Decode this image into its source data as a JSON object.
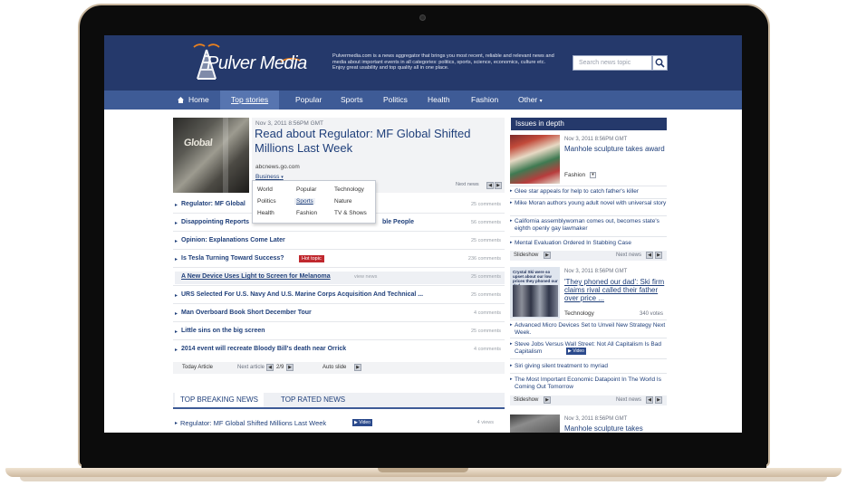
{
  "header": {
    "logo_text": "Pulver Media",
    "tagline": "Pulvermedia.com is a news aggregator that brings you most recent, reliable and relevant news and media about important events in all categories: politics, sports, science, economics, culture etc. Enjoy great usability and top quality all in one place.",
    "search_placeholder": "Search news topic"
  },
  "nav": {
    "home": "Home",
    "items": [
      "Top stories",
      "Popular",
      "Sports",
      "Politics",
      "Health",
      "Fashion",
      "Other"
    ],
    "active": "Top stories"
  },
  "featured": {
    "date": "Nov 3, 2011 8:56PM GMT",
    "title": "Read about Regulator: MF Global Shifted Millions Last Week",
    "source": "abcnews.go.com",
    "category": "Business",
    "image_text": "Global",
    "next_news": "Next news"
  },
  "category_dropdown": {
    "items": [
      [
        "World",
        "Popular",
        "Technology"
      ],
      [
        "Politics",
        "Sports",
        "Nature"
      ],
      [
        "Health",
        "Fashion",
        "TV & Shows"
      ]
    ],
    "active": "Sports"
  },
  "stories": [
    {
      "title": "Regulator: MF Global",
      "comments": "25 comments"
    },
    {
      "title": "Disappointing Reports",
      "title_tail": "ble People",
      "comments": "56 comments"
    },
    {
      "title": "Opinion: Explanations Come Later",
      "comments": "25 comments"
    },
    {
      "title": "Is Tesla Turning Toward Success?",
      "badge": "Hot topic",
      "comments": "236 comments"
    },
    {
      "title": "A New Device Uses Light to Screen for Melanoma",
      "extra": "view news",
      "comments": "25 comments"
    },
    {
      "title": "URS Selected For U.S. Navy And U.S. Marine Corps Acquisition And Technical ...",
      "comments": "25 comments"
    },
    {
      "title": "Man Overboard Book Short December Tour",
      "comments": "4 comments"
    },
    {
      "title": "Little sins on the big screen",
      "comments": "25 comments"
    },
    {
      "title": "2014 event will recreate Bloody Bill's death near Orrick",
      "comments": "4 comments"
    }
  ],
  "pager": {
    "today": "Today Article",
    "next": "Next article",
    "count": "2/9",
    "auto": "Auto slide"
  },
  "tabs": [
    "TOP BREAKING NEWS",
    "TOP RATED NEWS"
  ],
  "breaking": {
    "title": "Regulator: MF Global Shifted Millions Last Week",
    "badge": "Video",
    "views": "4 views"
  },
  "right": {
    "header": "Issues in depth",
    "block1": {
      "date": "Nov 3, 2011 8:56PM GMT",
      "title": "Manhole sculpture takes award",
      "category": "Fashion"
    },
    "list1": [
      "Glee star appeals for help to catch father's killer",
      "Mike Moran authors young adult novel with universal story",
      "California assemblywoman comes out, becomes state's eighth openly gay lawmaker",
      "Mental Evaluation Ordered In Stabbing Case"
    ],
    "bar_label": "Slideshow",
    "bar_next": "Next news",
    "block2": {
      "date": "Nov 3, 2011 8:56PM GMT",
      "title": "'They phoned our dad': Ski firm claims rival called their father over price ...",
      "category": "Technology",
      "votes": "340 votes",
      "image_text": "Crystal Ski were so upset about our low prices they phoned our dad"
    },
    "list2": [
      "Advanced Micro Devices Set to Unveil New Strategy Next Week.",
      "Steve Jobs Versus Wall Street: Not All Capitalism Is Bad Capitalism",
      "Siri giving silent treatment to myriad",
      "The Most Important Economic Datapoint In The World Is Coming Out Tomorrow"
    ],
    "list2_badge": "Video",
    "block3": {
      "date": "Nov 3, 2011 8:56PM GMT",
      "title": "Manhole sculpture takes"
    }
  }
}
